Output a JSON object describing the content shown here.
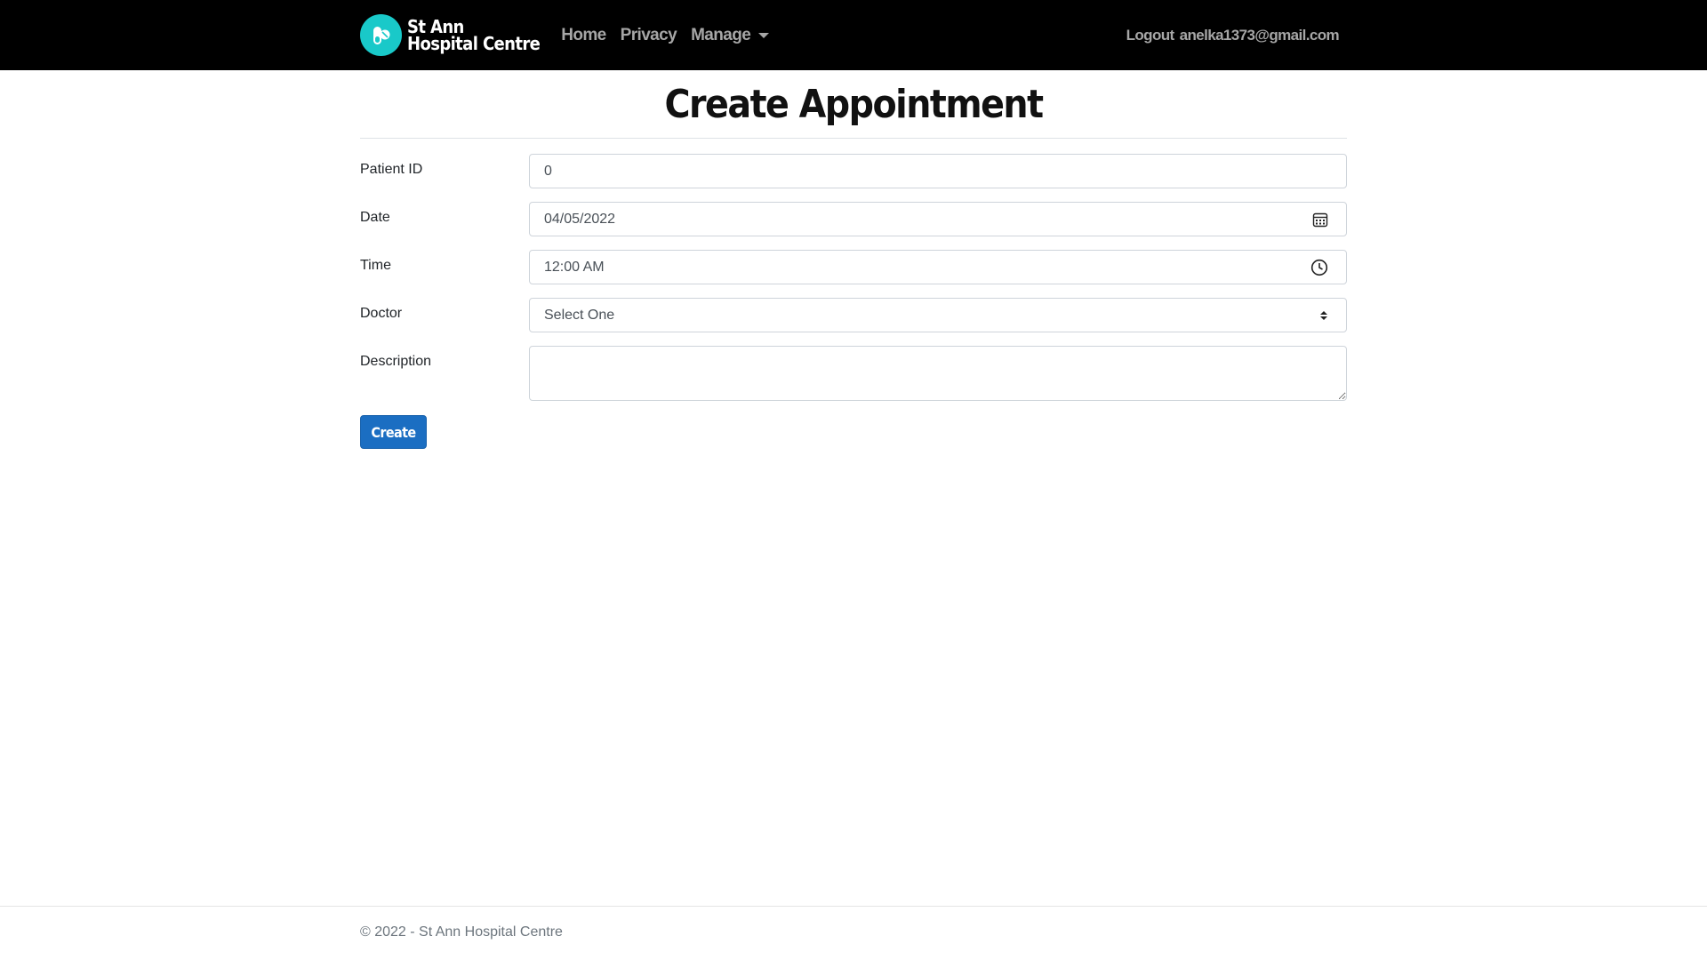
{
  "navbar": {
    "brand_line1": "St Ann",
    "brand_line2": "Hospital Centre",
    "links": [
      "Home",
      "Privacy",
      "Manage"
    ],
    "logout_label": "Logout",
    "user_email": "anelka1373@gmail.com"
  },
  "page": {
    "title": "Create Appointment"
  },
  "form": {
    "patient_id_label": "Patient ID",
    "patient_id_value": "0",
    "date_label": "Date",
    "date_value": "04/05/2022",
    "time_label": "Time",
    "time_value": "12:00 AM",
    "doctor_label": "Doctor",
    "doctor_value": "Select One",
    "description_label": "Description",
    "description_value": "",
    "submit_label": "Create"
  },
  "footer": {
    "text": "© 2022 - St Ann Hospital Centre"
  },
  "colors": {
    "navbar_bg": "#000000",
    "brand_logo": "#19c9c9",
    "primary_button": "#1b6ec2"
  },
  "icons": [
    "pill-logo-icon",
    "calendar-icon",
    "clock-icon",
    "select-arrows-icon",
    "caret-down-icon"
  ]
}
